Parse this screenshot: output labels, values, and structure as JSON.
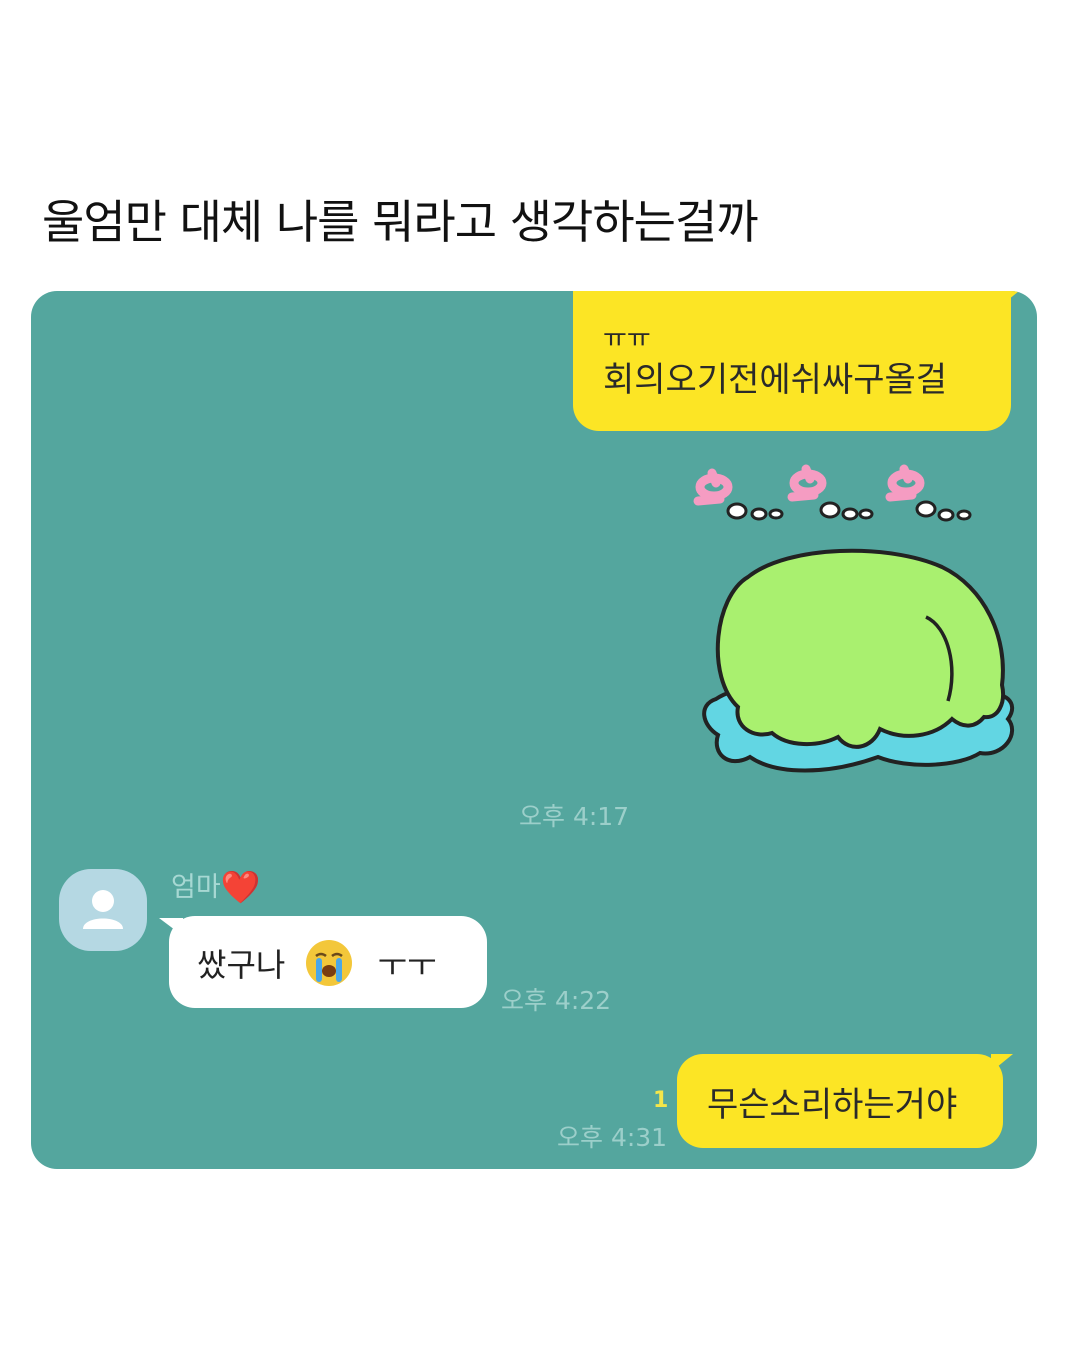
{
  "caption": "울엄만 대체 나를 뭐라고 생각하는걸까",
  "messages": [
    {
      "id": "m1",
      "from": "me",
      "line1": "ㅠㅠ",
      "line2": "회의오기전에쉬싸구올걸"
    },
    {
      "id": "m2",
      "from": "me",
      "type": "sticker",
      "sticker_text": "엉..엉..엉..",
      "time": "오후 4:17"
    },
    {
      "id": "m3",
      "from": "other",
      "sender": "엄마",
      "sender_heart": "❤️",
      "text_before": "쌌구나",
      "emoji": "crying-face",
      "text_after": "ㅜㅜ",
      "time": "오후 4:22"
    },
    {
      "id": "m4",
      "from": "me",
      "text": "무슨소리하는거야",
      "unread": "1",
      "time": "오후 4:31"
    }
  ],
  "colors": {
    "chat_background": "#54a69e",
    "my_bubble": "#fce525",
    "other_bubble": "#ffffff",
    "sticker_frog": "#a9f06f",
    "sticker_puddle": "#62d6e3",
    "sticker_text": "#f59cc2"
  }
}
